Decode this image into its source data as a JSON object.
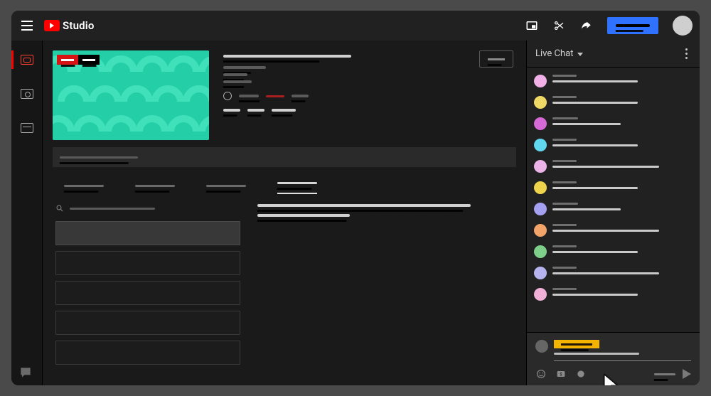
{
  "colors": {
    "accent_blue": "#2e72ff",
    "brand_red": "#ff0000",
    "thumb_bg": "#24cfa7"
  },
  "topbar": {
    "brand": "Studio",
    "menu_icon": "menu-icon",
    "popout_icon": "popout-icon",
    "cut_icon": "scissors-icon",
    "share_icon": "share-icon",
    "stream_button_label": "━━━━",
    "avatar": "user-avatar"
  },
  "rail": {
    "items": [
      {
        "name": "stream",
        "active": true
      },
      {
        "name": "webcam",
        "active": false
      },
      {
        "name": "manage",
        "active": false
      }
    ]
  },
  "info": {
    "title_line": "━━━━━━━━━━━━━━",
    "sub_lines": [
      "━━━━",
      "━━━",
      "━━━"
    ],
    "meta_row_1_label": "━━━",
    "meta_row_1_value": "━━",
    "meta_row_2_a": "━━",
    "meta_row_2_b": "━━",
    "meta_row_2_c": "━━━",
    "thumb_badge_live": "━━",
    "thumb_badge_time": "━━",
    "edit_button": "━━"
  },
  "subbar_line": "━━━━━━━━━━",
  "tabs": {
    "items": [
      "━━━━━",
      "━━━━━",
      "━━━━━",
      "━━━━━"
    ],
    "active_index": 3
  },
  "content": {
    "search_placeholder": "━━━━━━━━━━",
    "list_rows": 5,
    "selected_row": 0,
    "right_lines": [
      "━━━━━━━━━━━━━━━━━━━━━━━━━━━━━━",
      "━━━━━━━━━━━━━"
    ]
  },
  "chat": {
    "header": "Live Chat",
    "messages": [
      {
        "avatar_color": "#f1b0e8",
        "name_w": 34,
        "text_w": 120
      },
      {
        "avatar_color": "#f0d867",
        "name_w": 34,
        "text_w": 120
      },
      {
        "avatar_color": "#d76ad7",
        "name_w": 36,
        "text_w": 96
      },
      {
        "avatar_color": "#61d7f0",
        "name_w": 34,
        "text_w": 120
      },
      {
        "avatar_color": "#ecb3e8",
        "name_w": 34,
        "text_w": 150
      },
      {
        "avatar_color": "#efd34d",
        "name_w": 34,
        "text_w": 120
      },
      {
        "avatar_color": "#a6a0f2",
        "name_w": 36,
        "text_w": 96
      },
      {
        "avatar_color": "#f2a469",
        "name_w": 34,
        "text_w": 150
      },
      {
        "avatar_color": "#7ecf89",
        "name_w": 34,
        "text_w": 120
      },
      {
        "avatar_color": "#b7b3f0",
        "name_w": 34,
        "text_w": 150
      },
      {
        "avatar_color": "#f0b0d7",
        "name_w": 34,
        "text_w": 120
      }
    ],
    "input_name": "━━━━",
    "input_placeholder": "━━━━━━━━",
    "char_count": "━━",
    "emoji_icon": "emoji-icon",
    "superchat_icon": "superchat-icon",
    "poll_icon": "poll-icon",
    "send_icon": "send-icon"
  },
  "feedback_icon": "feedback-icon"
}
